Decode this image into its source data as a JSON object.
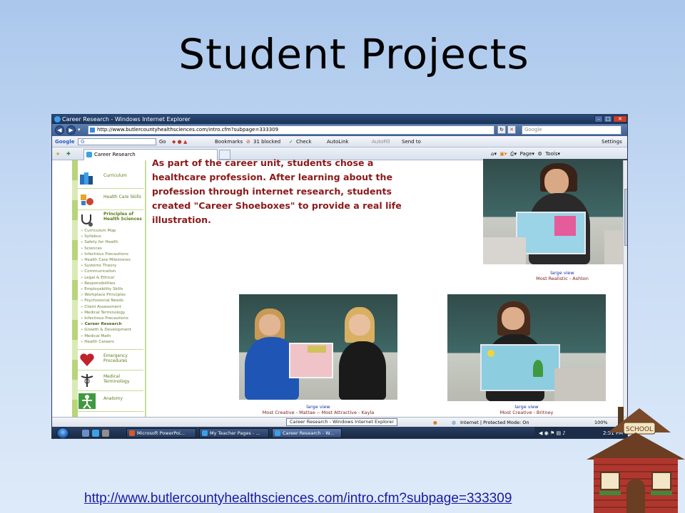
{
  "slide": {
    "title": "Student Projects",
    "link": "http://www.butlercountyhealthsciences.com/intro.cfm?subpage=333309"
  },
  "browser": {
    "window_title": "Career Research - Windows Internet Explorer",
    "address": "http://www.butlercountyhealthsciences.com/intro.cfm?subpage=333309",
    "search_placeholder": "Google",
    "google_toolbar": {
      "logo": "Google",
      "search_label": "G",
      "go": "Go",
      "bookmarks": "Bookmarks",
      "blocked": "31 blocked",
      "check": "Check",
      "autolink": "AutoLink",
      "autofill": "AutoFill",
      "sendto": "Send to",
      "settings": "Settings"
    },
    "tab_label": "Career Research",
    "commands": {
      "page": "Page",
      "tools": "Tools"
    },
    "status": {
      "zone": "Internet | Protected Mode: On",
      "zoom": "100%"
    },
    "tooltip": "Career Research - Windows Internet Explorer"
  },
  "sidebar": {
    "sections": [
      {
        "label": "Curriculum",
        "icon": "books-icon"
      },
      {
        "label": "Health Care Skills",
        "icon": "toys-icon"
      },
      {
        "label": "Principles of Health Sciences",
        "icon": "stethoscope-icon"
      },
      {
        "label": "Emergency Procedures",
        "icon": "heart-icon"
      },
      {
        "label": "Medical Terminology",
        "icon": "caduceus-icon"
      },
      {
        "label": "Anatomy",
        "icon": "body-icon"
      }
    ],
    "links": [
      "Curriculum Map",
      "Syllabus",
      "Safety for Health",
      "Sciences",
      "Infectious Precautions",
      "Health Care Milestones",
      "Systems Theory",
      "Communication",
      "Legal & Ethical",
      "Responsibilities",
      "Employability Skills",
      "Workplace Principles",
      "Psychosocial Needs",
      "Client Assessment",
      "Medical Terminology",
      "Infectious Precautions",
      "Career Research",
      "Growth & Development",
      "Medical Math",
      "Health Careers"
    ]
  },
  "content": {
    "paragraph": "As part of the career unit, students chose a healthcare profession.  After learning about the profession through internet research, students created \"Career Shoeboxes\" to provide a real life illustration.",
    "photos": [
      {
        "link": "large view",
        "caption": "Most Realistic - Ashton"
      },
      {
        "link": "large view",
        "caption": "Most Creative - Mattae -- Most Attractive - Kayla"
      },
      {
        "link": "large view",
        "caption": "Most Creative - Britney"
      }
    ]
  },
  "taskbar": {
    "buttons": [
      "Microsoft PowerPoi...",
      "My Teacher Pages - ...",
      "Career Research - W..."
    ],
    "clock": "2:51 PM"
  },
  "colors": {
    "heading_text": "#8b1a1a",
    "sidebar_green": "#b9d47b",
    "link_blue": "#1b2fa8"
  }
}
